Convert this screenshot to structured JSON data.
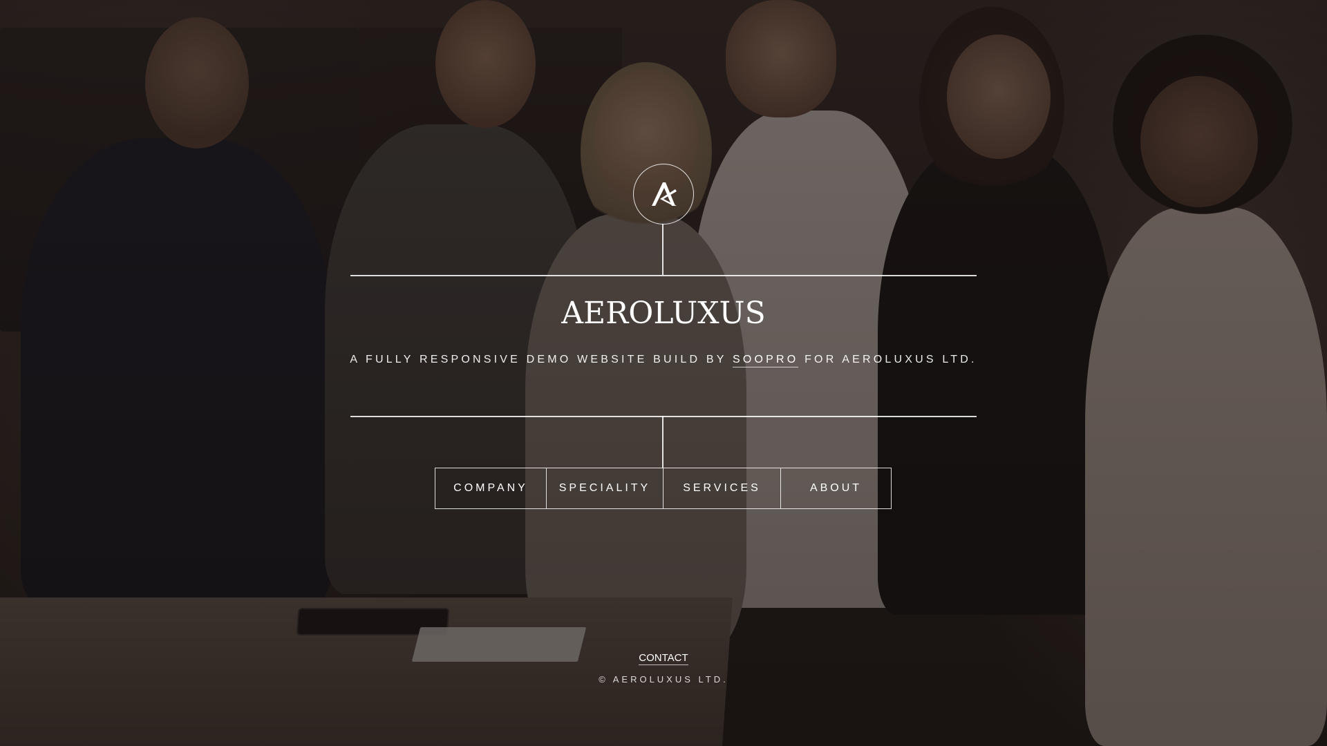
{
  "brand": {
    "logo_icon": "ak-monogram-icon",
    "title": "AEROLUXUS"
  },
  "tagline": {
    "before": "A FULLY RESPONSIVE DEMO WEBSITE BUILD BY ",
    "link": "SOOPRO",
    "after": " FOR AEROLUXUS LTD."
  },
  "nav": {
    "items": [
      {
        "label": "COMPANY"
      },
      {
        "label": "SPECIALITY"
      },
      {
        "label": "SERVICES"
      },
      {
        "label": "ABOUT"
      }
    ]
  },
  "footer": {
    "contact": "CONTACT",
    "copyright": "© AEROLUXUS LTD."
  },
  "colors": {
    "text": "#ffffff",
    "overlay": "#140e0c"
  }
}
